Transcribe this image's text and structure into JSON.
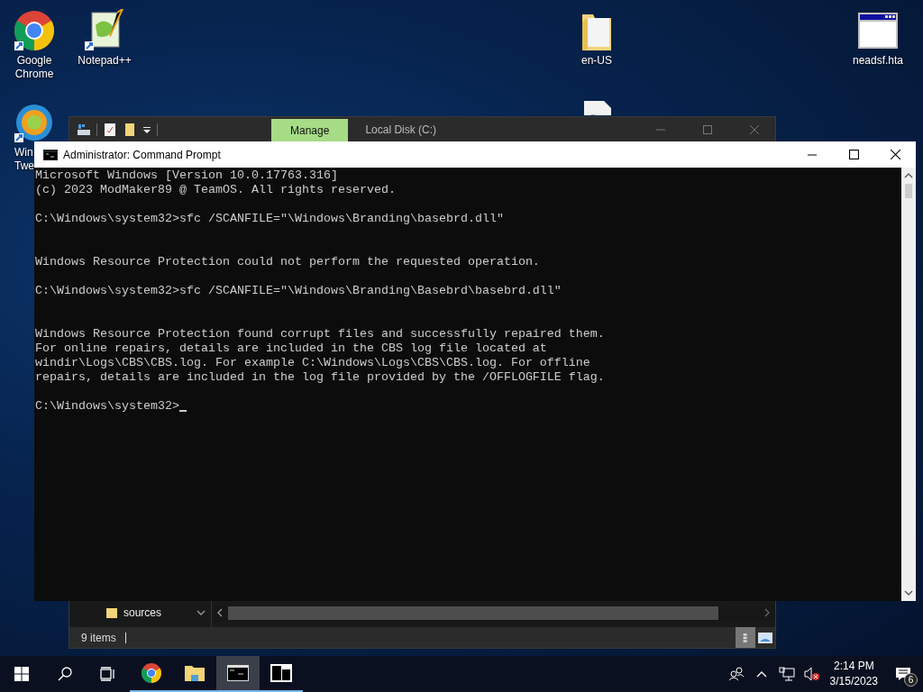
{
  "desktop_icons": [
    {
      "kind": "chrome",
      "label": "Google Chrome"
    },
    {
      "kind": "tweaker",
      "label": "Win Twe"
    },
    {
      "kind": "notepadpp",
      "label": "Notepad++"
    },
    {
      "kind": "folder",
      "label": "en-US"
    },
    {
      "kind": "file"
    },
    {
      "kind": "hta",
      "label": "neadsf.hta"
    }
  ],
  "explorer": {
    "contextual_tab": "Manage",
    "title": "Local Disk (C:)",
    "nav_items": [
      {
        "label": "sources"
      }
    ],
    "status": "9 items"
  },
  "cmd": {
    "title": "Administrator: Command Prompt",
    "lines": [
      {
        "kind": "text",
        "text": "Microsoft Windows [Version 10.0.17763.316]"
      },
      {
        "kind": "text",
        "text": "(c) 2023 ModMaker89 @ TeamOS. All rights reserved."
      },
      {
        "kind": "blank"
      },
      {
        "kind": "text",
        "text": "C:\\Windows\\system32>sfc /SCANFILE=\"\\Windows\\Branding\\basebrd.dll\""
      },
      {
        "kind": "blank"
      },
      {
        "kind": "blank"
      },
      {
        "kind": "text",
        "text": "Windows Resource Protection could not perform the requested operation."
      },
      {
        "kind": "blank"
      },
      {
        "kind": "text",
        "text": "C:\\Windows\\system32>sfc /SCANFILE=\"\\Windows\\Branding\\Basebrd\\basebrd.dll\""
      },
      {
        "kind": "blank"
      },
      {
        "kind": "blank"
      },
      {
        "kind": "text",
        "text": "Windows Resource Protection found corrupt files and successfully repaired them."
      },
      {
        "kind": "text",
        "text": "For online repairs, details are included in the CBS log file located at"
      },
      {
        "kind": "text",
        "text": "windir\\Logs\\CBS\\CBS.log. For example C:\\Windows\\Logs\\CBS\\CBS.log. For offline"
      },
      {
        "kind": "text",
        "text": "repairs, details are included in the log file provided by the /OFFLOGFILE flag."
      },
      {
        "kind": "blank"
      },
      {
        "kind": "text",
        "text": "C:\\Windows\\system32>",
        "cursor": true
      }
    ]
  },
  "taskbar": {
    "apps": [
      {
        "kind": "start",
        "running": false,
        "selected": false
      },
      {
        "kind": "search",
        "running": false,
        "selected": false
      },
      {
        "kind": "taskview",
        "running": false,
        "selected": false
      },
      {
        "kind": "chrome",
        "running": true,
        "selected": false
      },
      {
        "kind": "explorer",
        "running": true,
        "selected": false
      },
      {
        "kind": "cmd",
        "running": true,
        "selected": true
      },
      {
        "kind": "sevenzip",
        "running": true,
        "selected": false
      }
    ],
    "volume": {
      "muted": true
    },
    "clock": {
      "time": "2:14 PM",
      "date": "3/15/2023"
    },
    "notifications": "6"
  }
}
